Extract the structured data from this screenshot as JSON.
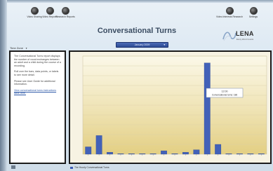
{
  "nav": {
    "left": [
      {
        "label": "Video Sharing",
        "icon": "video-sharing-icon"
      },
      {
        "label": "Video Reports",
        "icon": "video-reports-icon"
      },
      {
        "label": "Research Reports",
        "icon": "research-reports-icon"
      }
    ],
    "right": [
      {
        "label": "Video Interests Research",
        "icon": "video-interests-icon"
      },
      {
        "label": "Settings",
        "icon": "settings-icon"
      }
    ]
  },
  "page": {
    "title": "Conversational Turns",
    "date_selector": "January 2009"
  },
  "logo": {
    "brand": "LENA",
    "tagline": "Every Word Counts"
  },
  "filter": {
    "label": "Time  Zone"
  },
  "info_panel": {
    "p1": "The Conversational Turns report displays the number of vocal exchanges between an adult and a child during the course of a recording.",
    "p2": "Roll over the bars, data points, or labels to see more detail.",
    "p3": "Please see User Guide for additional information.",
    "link": "View conversational turns instructions table here."
  },
  "tooltip": {
    "title": "12:00",
    "body": "Conversational turns: 186"
  },
  "legend": {
    "label": "The Hourly Conversational Turns"
  },
  "chart_data": {
    "type": "bar",
    "series": [
      {
        "name": "The Hourly Conversational Turns",
        "values": [
          15,
          38,
          4,
          1,
          1,
          1,
          1,
          7,
          1,
          4,
          9,
          186,
          20,
          1,
          1,
          1,
          1
        ]
      }
    ],
    "ylim": [
      0,
      200
    ],
    "grid": true
  }
}
